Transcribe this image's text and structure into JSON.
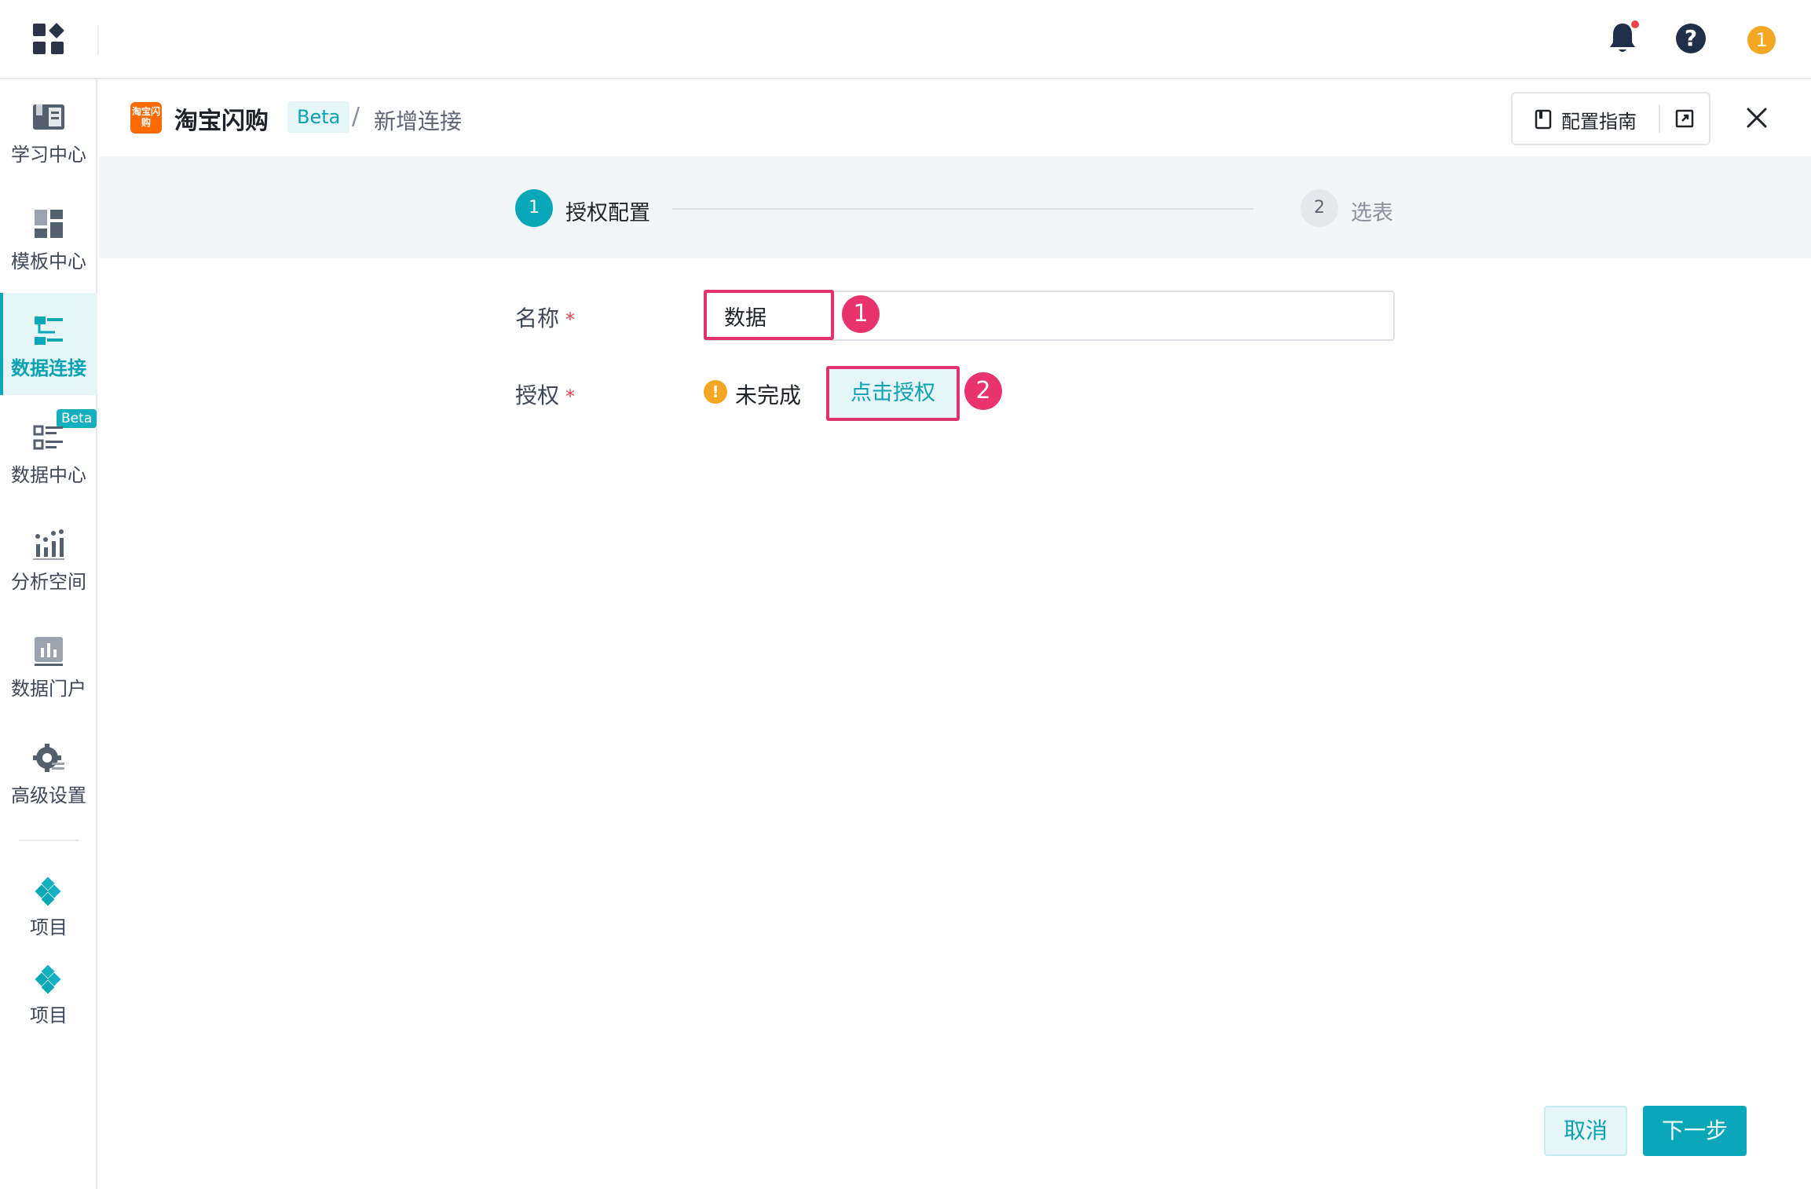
{
  "topbar": {
    "notification_icon": "bell-icon",
    "help_icon": "question-circle-icon",
    "help_glyph": "?",
    "user_avatar": "1"
  },
  "sidebar": {
    "items": [
      {
        "label": "学习中心",
        "icon": "book-icon"
      },
      {
        "label": "模板中心",
        "icon": "template-icon"
      },
      {
        "label": "数据连接",
        "icon": "data-connection-icon",
        "active": true
      },
      {
        "label": "数据中心",
        "icon": "data-center-icon",
        "badge": "Beta"
      },
      {
        "label": "分析空间",
        "icon": "analysis-icon"
      },
      {
        "label": "数据门户",
        "icon": "portal-icon"
      },
      {
        "label": "高级设置",
        "icon": "settings-icon"
      }
    ],
    "projects": [
      {
        "label": "项目",
        "icon": "project-icon"
      },
      {
        "label": "项目",
        "icon": "project-icon"
      }
    ]
  },
  "header": {
    "logo_text": "淘宝闪购",
    "title": "淘宝闪购",
    "beta": "Beta",
    "separator": "/",
    "page": "新增连接",
    "guide_label": "配置指南",
    "close_glyph": "×"
  },
  "steps": [
    {
      "number": "1",
      "label": "授权配置",
      "active": true
    },
    {
      "number": "2",
      "label": "选表",
      "active": false
    }
  ],
  "form": {
    "name_label": "名称",
    "name_value": "数据",
    "auth_label": "授权",
    "required_mark": "*",
    "auth_status": "未完成",
    "auth_button": "点击授权",
    "warn_glyph": "!"
  },
  "annotations": [
    "1",
    "2"
  ],
  "footer": {
    "cancel": "取消",
    "next": "下一步"
  },
  "colors": {
    "accent": "#0aa7b8",
    "highlight": "#e0336e",
    "warning": "#f5a623",
    "brand": "#ff6a00"
  }
}
